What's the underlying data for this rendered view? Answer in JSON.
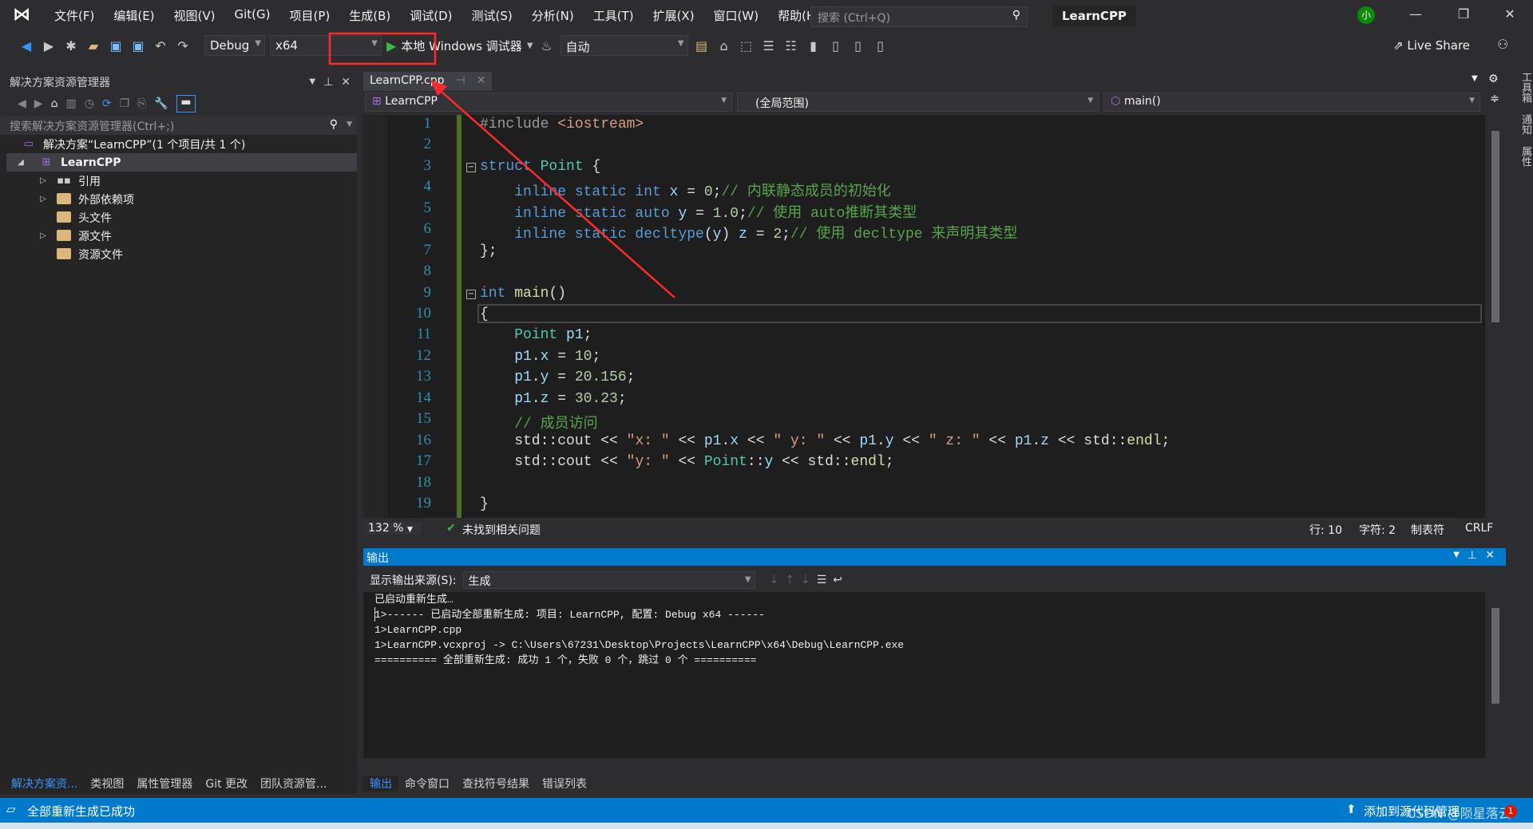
{
  "menubar": {
    "items": [
      "文件(F)",
      "编辑(E)",
      "视图(V)",
      "Git(G)",
      "项目(P)",
      "生成(B)",
      "调试(D)",
      "测试(S)",
      "分析(N)",
      "工具(T)",
      "扩展(X)",
      "窗口(W)",
      "帮助(H)"
    ],
    "search_placeholder": "搜索 (Ctrl+Q)",
    "project_title": "LearnCPP",
    "avatar": "小"
  },
  "toolbar": {
    "config": "Debug",
    "platform": "x64",
    "debugger": "本地 Windows 调试器",
    "target": "自动",
    "live_share": "Live Share"
  },
  "solution_explorer": {
    "title": "解决方案资源管理器",
    "search_placeholder": "搜索解决方案资源管理器(Ctrl+;)",
    "solution": "解决方案“LearnCPP”(1 个项目/共 1 个)",
    "project": "LearnCPP",
    "items": [
      {
        "label": "引用",
        "expandable": true
      },
      {
        "label": "外部依赖项",
        "expandable": true
      },
      {
        "label": "头文件",
        "expandable": false
      },
      {
        "label": "源文件",
        "expandable": true
      },
      {
        "label": "资源文件",
        "expandable": false
      }
    ],
    "bottom_tabs": [
      "解决方案资...",
      "类视图",
      "属性管理器",
      "Git 更改",
      "团队资源管..."
    ]
  },
  "editor": {
    "tab": "LearnCPP.cpp",
    "nav_project": "LearnCPP",
    "nav_scope": "(全局范围)",
    "nav_member": "main()",
    "lines": [
      [
        [
          "#include ",
          "t-pp"
        ],
        [
          "<iostream>",
          "t-inc"
        ]
      ],
      [],
      [
        [
          "struct ",
          "t-kw"
        ],
        [
          "Point ",
          "t-type"
        ],
        [
          "{",
          ""
        ]
      ],
      [
        [
          "    inline static int ",
          "t-kw"
        ],
        [
          "x ",
          "t-var"
        ],
        [
          "= ",
          ""
        ],
        [
          "0",
          "t-num"
        ],
        [
          ";",
          ""
        ],
        [
          "// 内联静态成员的初始化",
          "t-cm"
        ]
      ],
      [
        [
          "    inline static auto ",
          "t-kw"
        ],
        [
          "y ",
          "t-var"
        ],
        [
          "= ",
          ""
        ],
        [
          "1.0",
          "t-num"
        ],
        [
          ";",
          ""
        ],
        [
          "// 使用 auto推断其类型",
          "t-cm"
        ]
      ],
      [
        [
          "    inline static decltype",
          "t-kw"
        ],
        [
          "(",
          ""
        ],
        [
          "y",
          "t-var"
        ],
        [
          ") ",
          ""
        ],
        [
          "z ",
          "t-var"
        ],
        [
          "= ",
          ""
        ],
        [
          "2",
          "t-num"
        ],
        [
          ";",
          ""
        ],
        [
          "// 使用 decltype 来声明其类型",
          "t-cm"
        ]
      ],
      [
        [
          "};",
          ""
        ]
      ],
      [],
      [
        [
          "int ",
          "t-kw"
        ],
        [
          "main",
          "t-fn"
        ],
        [
          "()",
          ""
        ]
      ],
      [
        [
          "{",
          ""
        ]
      ],
      [
        [
          "    Point ",
          "t-type"
        ],
        [
          "p1",
          "t-var"
        ],
        [
          ";",
          ""
        ]
      ],
      [
        [
          "    p1",
          "t-var"
        ],
        [
          ".",
          ""
        ],
        [
          "x ",
          "t-var"
        ],
        [
          "= ",
          ""
        ],
        [
          "10",
          "t-num"
        ],
        [
          ";",
          ""
        ]
      ],
      [
        [
          "    p1",
          "t-var"
        ],
        [
          ".",
          ""
        ],
        [
          "y ",
          "t-var"
        ],
        [
          "= ",
          ""
        ],
        [
          "20.156",
          "t-num"
        ],
        [
          ";",
          ""
        ]
      ],
      [
        [
          "    p1",
          "t-var"
        ],
        [
          ".",
          ""
        ],
        [
          "z ",
          "t-var"
        ],
        [
          "= ",
          ""
        ],
        [
          "30.23",
          "t-num"
        ],
        [
          ";",
          ""
        ]
      ],
      [
        [
          "    // 成员访问",
          "t-cm"
        ]
      ],
      [
        [
          "    std::",
          ""
        ],
        [
          "cout ",
          ""
        ],
        [
          "<< ",
          ""
        ],
        [
          "\"x: \"",
          "t-str"
        ],
        [
          " << ",
          ""
        ],
        [
          "p1",
          "t-var"
        ],
        [
          ".",
          ""
        ],
        [
          "x",
          "t-var"
        ],
        [
          " << ",
          ""
        ],
        [
          "\" y: \"",
          "t-str"
        ],
        [
          " << ",
          ""
        ],
        [
          "p1",
          "t-var"
        ],
        [
          ".",
          ""
        ],
        [
          "y",
          "t-var"
        ],
        [
          " << ",
          ""
        ],
        [
          "\" z: \"",
          "t-str"
        ],
        [
          " << ",
          ""
        ],
        [
          "p1",
          "t-var"
        ],
        [
          ".",
          ""
        ],
        [
          "z",
          "t-var"
        ],
        [
          " << std::",
          ""
        ],
        [
          "endl",
          "t-fn"
        ],
        [
          ";",
          ""
        ]
      ],
      [
        [
          "    std::cout << ",
          ""
        ],
        [
          "\"y: \"",
          "t-str"
        ],
        [
          " << ",
          ""
        ],
        [
          "Point",
          "t-type"
        ],
        [
          "::",
          ""
        ],
        [
          "y",
          "t-var"
        ],
        [
          " << std::",
          ""
        ],
        [
          "endl",
          "t-fn"
        ],
        [
          ";",
          ""
        ]
      ],
      [],
      [
        [
          "}",
          ""
        ]
      ]
    ],
    "status": {
      "zoom": "132 %",
      "issues": "未找到相关问题",
      "line": "行: 10",
      "char": "字符: 2",
      "indent": "制表符",
      "eol": "CRLF"
    }
  },
  "output": {
    "title": "输出",
    "source_label": "显示输出来源(S):",
    "source": "生成",
    "lines": [
      "已启动重新生成…",
      "1>------ 已启动全部重新生成: 项目: LearnCPP, 配置: Debug x64 ------",
      "1>LearnCPP.cpp",
      "1>LearnCPP.vcxproj -> C:\\Users\\67231\\Desktop\\Projects\\LearnCPP\\x64\\Debug\\LearnCPP.exe",
      "========== 全部重新生成: 成功 1 个，失败 0 个，跳过 0 个 =========="
    ],
    "bottom_tabs": [
      "输出",
      "命令窗口",
      "查找符号结果",
      "错误列表"
    ]
  },
  "right_strip": [
    "工具箱",
    "通知",
    "属性"
  ],
  "statusbar": {
    "message": "全部重新生成已成功",
    "source_control": "添加到源代码管理",
    "notifications": "1",
    "watermark": "CSDN @陨星落云"
  },
  "colors": {
    "accent": "#007acc",
    "annotation": "#ff2a2a"
  }
}
